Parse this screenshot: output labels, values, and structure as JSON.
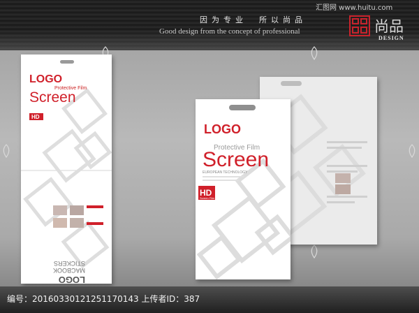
{
  "header": {
    "slogan_cn": "因为专业　所以尚品",
    "slogan_en": "Good design from the concept of professional",
    "watermark": "汇图网 www.huitu.com"
  },
  "brand": {
    "name_cn": "尚品",
    "design": "DESIGN"
  },
  "package": {
    "logo": "LOGO",
    "subtitle": "Protective Film",
    "title": "Screen",
    "tech": "EUROPEAN TECHNOLOGY",
    "badge": "HD",
    "badge_sub": "Screen Film",
    "flipped_logo": "LOGO",
    "flipped_line1": "MACBOOK",
    "flipped_line2": "STICKERS"
  },
  "footer": {
    "caption": "编号：20160330121251170143 上传者ID：387"
  },
  "colors": {
    "brand_red": "#d0202a",
    "seal_red": "#c9232c",
    "card_white": "#ffffff",
    "back_card": "#ebebeb"
  }
}
